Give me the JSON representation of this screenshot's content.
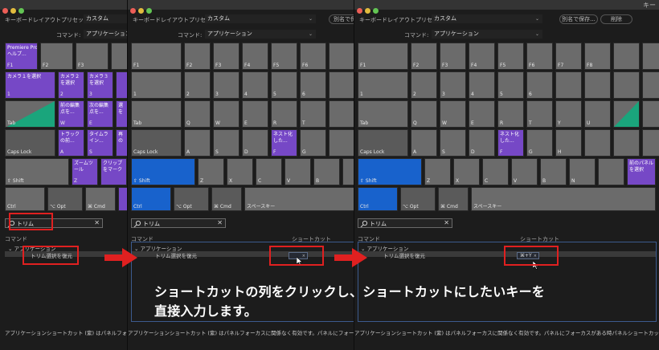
{
  "window_title": "キー",
  "preset": {
    "label": "キーボードレイアウトプリセット:",
    "value": "カスタム"
  },
  "command": {
    "label": "コマンド:",
    "value": "アプリケーション"
  },
  "buttons": {
    "save_as": "別名で保存...",
    "save_as_short": "別名で保",
    "delete": "削除"
  },
  "keys": {
    "f1": "F1",
    "f2": "F2",
    "f3": "F3",
    "f4": "F4",
    "f5": "F5",
    "f6": "F6",
    "f7": "F7",
    "f8": "F8",
    "n1": "1",
    "n2": "2",
    "n3": "3",
    "n4": "4",
    "n5": "5",
    "n6": "6",
    "tab": "Tab",
    "q": "Q",
    "w": "W",
    "e": "E",
    "r": "R",
    "t": "T",
    "y": "Y",
    "u": "U",
    "caps": "Caps Lock",
    "a": "A",
    "s": "S",
    "d": "D",
    "f": "F",
    "g": "G",
    "h": "H",
    "shift": "⇧ Shift",
    "z": "Z",
    "x": "X",
    "c": "C",
    "v": "V",
    "b": "B",
    "n": "N",
    "ctrl": "Ctrl",
    "opt": "⌥ Opt",
    "cmd": "⌘ Cmd",
    "space": "スペースキー"
  },
  "assigned": {
    "premiere_help": "Premiere Pro\nヘルプ...",
    "select_cam1": "カメラ１を選択",
    "select_cam2": "カメラ２\nを選択",
    "select_cam3": "カメラ３\nを選択",
    "edit_prev": "前の編集\n点を...",
    "edit_next": "次の編集\n点を...",
    "edit_trunc": "選\nを",
    "track_prev": "トラック\nの前...",
    "timeline_in": "タイムラ\nイン...",
    "ext_trunc": "再\nの",
    "zoom_tool": "ズームツ\nール",
    "clip_mark": "クリップ\nをマーク",
    "nest": "ネスト化\nした...",
    "next_panel": "前のパネル\nを選択"
  },
  "search": {
    "value": "トリム"
  },
  "columns": {
    "command": "コマンド",
    "shortcut": "ショートカット"
  },
  "tree": {
    "group": "アプリケーション",
    "item": "トリム選択を復元"
  },
  "shortcut_value": "⌘+Y",
  "instruction": {
    "line1": "ショートカットの列をクリックし、ショートカットにしたいキーを",
    "line2": "直接入力します。"
  },
  "footer": "アプリケーションショートカット (紫) はパネルフォーカスに関係なく有効です。パネルにフォーカスがある時パネルショートカット (緑) は上",
  "colors": {
    "purple": "#7648c6",
    "green": "#1aa57c",
    "blue": "#1862cc",
    "red": "#e02020",
    "key": "#6b6b6b"
  }
}
